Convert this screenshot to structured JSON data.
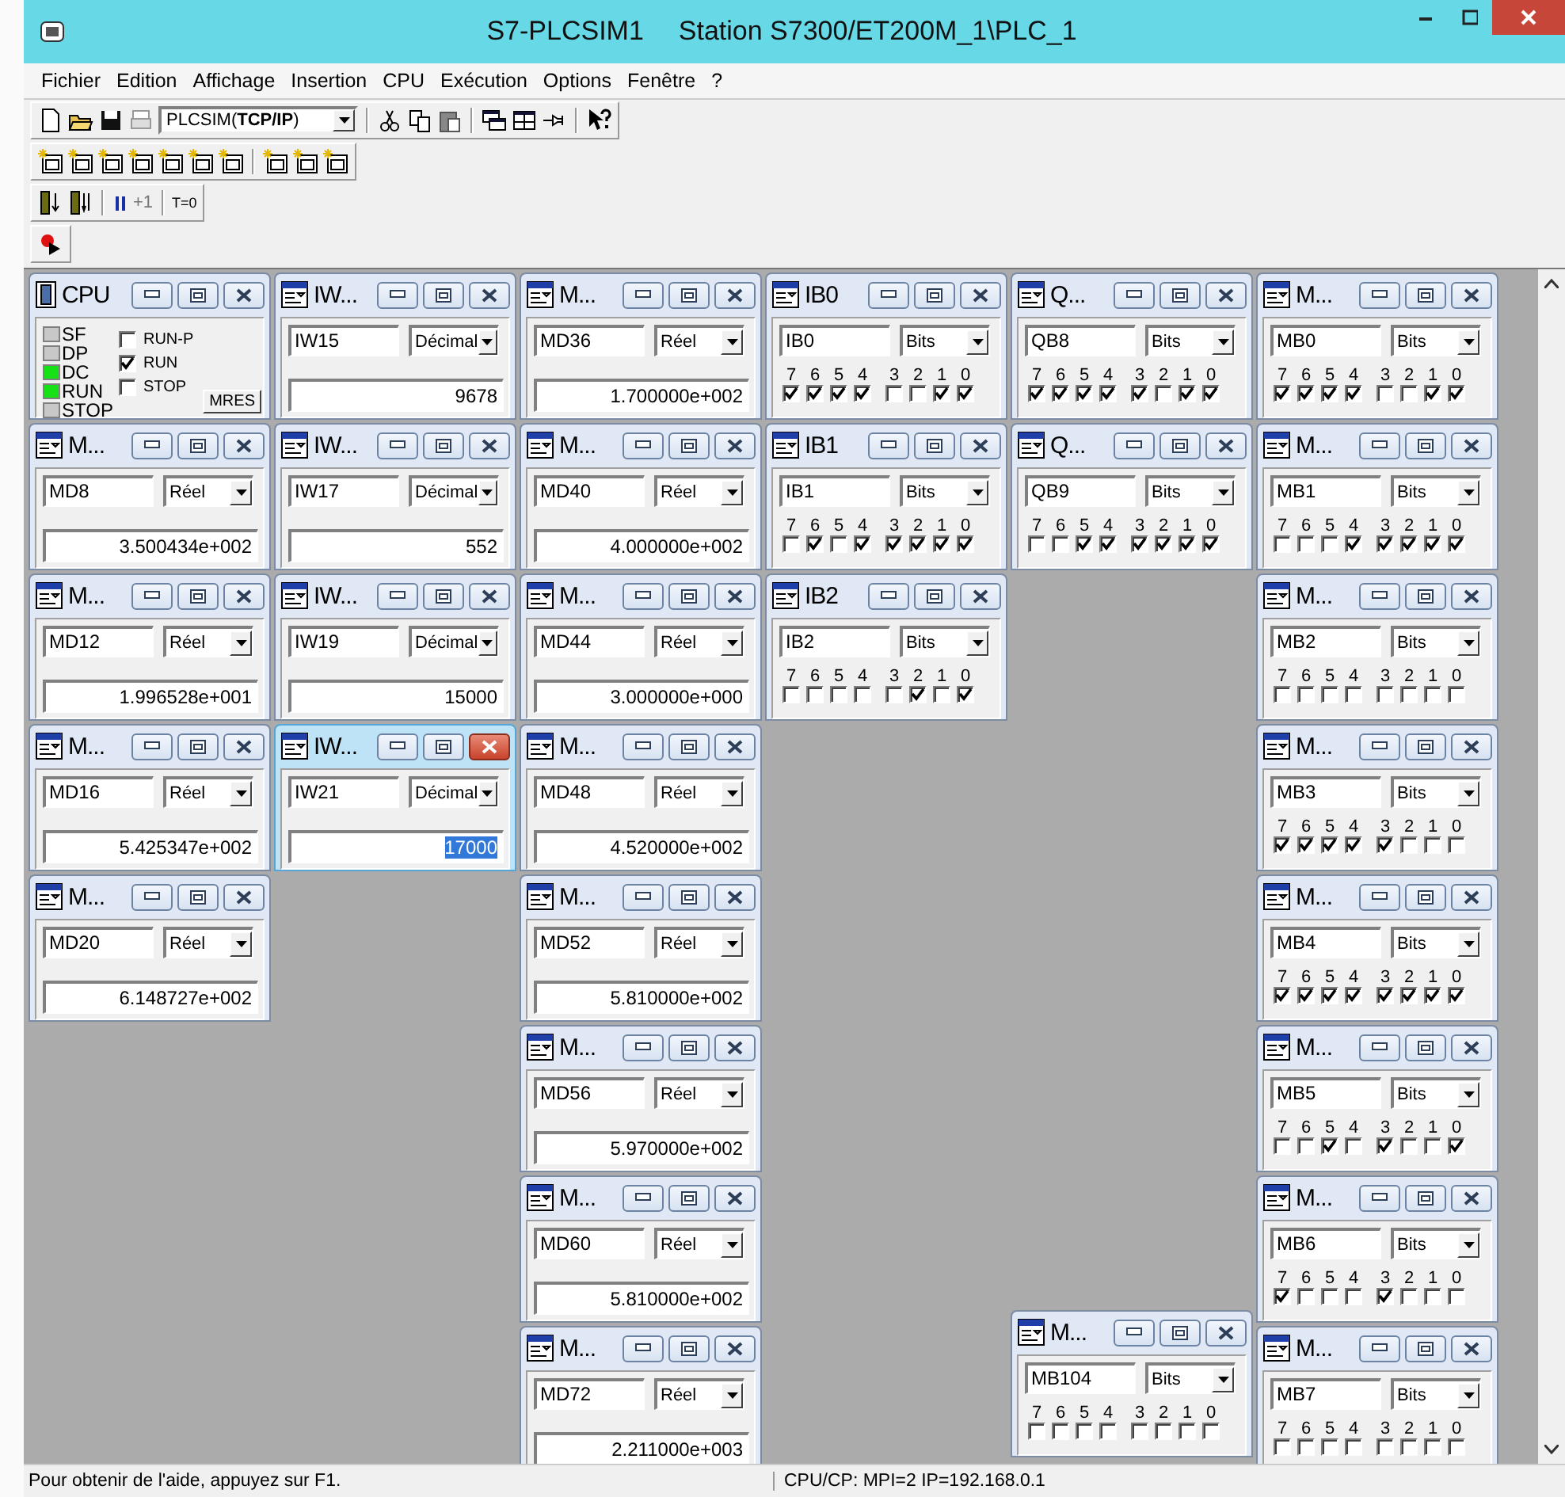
{
  "window": {
    "app": "S7-PLCSIM1",
    "station": "Station S7300/ET200M_1\\PLC_1"
  },
  "menu": [
    "Fichier",
    "Edition",
    "Affichage",
    "Insertion",
    "CPU",
    "Exécution",
    "Options",
    "Fenêtre",
    "?"
  ],
  "toolbar": {
    "connection": "PLCSIM(**TCP/IP**)",
    "step": "+1",
    "timer_reset": "T=0"
  },
  "columns": [
    {
      "windows": [
        {
          "kind": "cpu",
          "title": "CPU",
          "active": false,
          "leds": [
            {
              "label": "SF",
              "on": false
            },
            {
              "label": "DP",
              "on": false
            },
            {
              "label": "DC",
              "on": true
            },
            {
              "label": "RUN",
              "on": true
            },
            {
              "label": "STOP",
              "on": false
            }
          ],
          "modes": [
            {
              "label": "RUN-P",
              "checked": false
            },
            {
              "label": "RUN",
              "checked": true
            },
            {
              "label": "STOP",
              "checked": false
            }
          ],
          "button": "MRES"
        },
        {
          "kind": "value",
          "title": "M...",
          "active": false,
          "address": "MD8",
          "format": "Réel",
          "value": "3.500434e+002"
        },
        {
          "kind": "value",
          "title": "M...",
          "active": false,
          "address": "MD12",
          "format": "Réel",
          "value": "1.996528e+001"
        },
        {
          "kind": "value",
          "title": "M...",
          "active": false,
          "address": "MD16",
          "format": "Réel",
          "value": "5.425347e+002"
        },
        {
          "kind": "value",
          "title": "M...",
          "active": false,
          "address": "MD20",
          "format": "Réel",
          "value": "6.148727e+002"
        }
      ]
    },
    {
      "windows": [
        {
          "kind": "value",
          "title": "IW...",
          "active": false,
          "address": "IW15",
          "format": "Décimal",
          "value": "9678"
        },
        {
          "kind": "value",
          "title": "IW...",
          "active": false,
          "address": "IW17",
          "format": "Décimal",
          "value": "552"
        },
        {
          "kind": "value",
          "title": "IW...",
          "active": false,
          "address": "IW19",
          "format": "Décimal",
          "value": "15000"
        },
        {
          "kind": "value",
          "title": "IW...",
          "active": true,
          "address": "IW21",
          "format": "Décimal",
          "value": "17000"
        }
      ]
    },
    {
      "windows": [
        {
          "kind": "value",
          "title": "M...",
          "active": false,
          "address": "MD36",
          "format": "Réel",
          "value": "1.700000e+002"
        },
        {
          "kind": "value",
          "title": "M...",
          "active": false,
          "address": "MD40",
          "format": "Réel",
          "value": "4.000000e+002"
        },
        {
          "kind": "value",
          "title": "M...",
          "active": false,
          "address": "MD44",
          "format": "Réel",
          "value": "3.000000e+000"
        },
        {
          "kind": "value",
          "title": "M...",
          "active": false,
          "address": "MD48",
          "format": "Réel",
          "value": "4.520000e+002"
        },
        {
          "kind": "value",
          "title": "M...",
          "active": false,
          "address": "MD52",
          "format": "Réel",
          "value": "5.810000e+002"
        },
        {
          "kind": "value",
          "title": "M...",
          "active": false,
          "address": "MD56",
          "format": "Réel",
          "value": "5.970000e+002"
        },
        {
          "kind": "value",
          "title": "M...",
          "active": false,
          "address": "MD60",
          "format": "Réel",
          "value": "5.810000e+002"
        },
        {
          "kind": "value",
          "title": "M...",
          "active": false,
          "address": "MD72",
          "format": "Réel",
          "value": "2.211000e+003"
        }
      ]
    },
    {
      "windows": [
        {
          "kind": "bits",
          "title": "IB0",
          "active": false,
          "address": "IB0",
          "format": "Bits",
          "bits": [
            {
              "label": "7",
              "checked": true
            },
            {
              "label": "6",
              "checked": true
            },
            {
              "label": "5",
              "checked": true
            },
            {
              "label": "4",
              "checked": true
            },
            {
              "label": "3",
              "checked": false
            },
            {
              "label": "2",
              "checked": false
            },
            {
              "label": "1",
              "checked": true
            },
            {
              "label": "0",
              "checked": true
            }
          ]
        },
        {
          "kind": "bits",
          "title": "IB1",
          "active": false,
          "address": "IB1",
          "format": "Bits",
          "bits": [
            {
              "label": "7",
              "checked": false
            },
            {
              "label": "6",
              "checked": true
            },
            {
              "label": "5",
              "checked": false
            },
            {
              "label": "4",
              "checked": true
            },
            {
              "label": "3",
              "checked": true
            },
            {
              "label": "2",
              "checked": true
            },
            {
              "label": "1",
              "checked": true
            },
            {
              "label": "0",
              "checked": true
            }
          ]
        },
        {
          "kind": "bits",
          "title": "IB2",
          "active": false,
          "address": "IB2",
          "format": "Bits",
          "bits": [
            {
              "label": "7",
              "checked": false
            },
            {
              "label": "6",
              "checked": false
            },
            {
              "label": "5",
              "checked": false
            },
            {
              "label": "4",
              "checked": false
            },
            {
              "label": "3",
              "checked": false
            },
            {
              "label": "2",
              "checked": true
            },
            {
              "label": "1",
              "checked": false
            },
            {
              "label": "0",
              "checked": true
            }
          ]
        }
      ]
    },
    {
      "windows": [
        {
          "kind": "bits",
          "title": "Q...",
          "active": false,
          "address": "QB8",
          "format": "Bits",
          "bits": [
            {
              "label": "7",
              "checked": true
            },
            {
              "label": "6",
              "checked": true
            },
            {
              "label": "5",
              "checked": true
            },
            {
              "label": "4",
              "checked": true
            },
            {
              "label": "3",
              "checked": true
            },
            {
              "label": "2",
              "checked": false
            },
            {
              "label": "1",
              "checked": true
            },
            {
              "label": "0",
              "checked": true
            }
          ]
        },
        {
          "kind": "bits",
          "title": "Q...",
          "active": false,
          "address": "QB9",
          "format": "Bits",
          "bits": [
            {
              "label": "7",
              "checked": false
            },
            {
              "label": "6",
              "checked": false
            },
            {
              "label": "5",
              "checked": true
            },
            {
              "label": "4",
              "checked": true
            },
            {
              "label": "3",
              "checked": true
            },
            {
              "label": "2",
              "checked": true
            },
            {
              "label": "1",
              "checked": true
            },
            {
              "label": "0",
              "checked": true
            }
          ]
        },
        {
          "kind": "bits",
          "title": "M...",
          "active": false,
          "address": "MB104",
          "format": "Bits",
          "bits": [
            {
              "label": "7",
              "checked": false
            },
            {
              "label": "6",
              "checked": false
            },
            {
              "label": "5",
              "checked": false
            },
            {
              "label": "4",
              "checked": false
            },
            {
              "label": "3",
              "checked": false
            },
            {
              "label": "2",
              "checked": false
            },
            {
              "label": "1",
              "checked": false
            },
            {
              "label": "0",
              "checked": false
            }
          ]
        }
      ]
    },
    {
      "windows": [
        {
          "kind": "bits",
          "title": "M...",
          "active": false,
          "address": "MB0",
          "format": "Bits",
          "bits": [
            {
              "label": "7",
              "checked": true
            },
            {
              "label": "6",
              "checked": true
            },
            {
              "label": "5",
              "checked": true
            },
            {
              "label": "4",
              "checked": true
            },
            {
              "label": "3",
              "checked": false
            },
            {
              "label": "2",
              "checked": false
            },
            {
              "label": "1",
              "checked": true
            },
            {
              "label": "0",
              "checked": true
            }
          ]
        },
        {
          "kind": "bits",
          "title": "M...",
          "active": false,
          "address": "MB1",
          "format": "Bits",
          "bits": [
            {
              "label": "7",
              "checked": false
            },
            {
              "label": "6",
              "checked": false
            },
            {
              "label": "5",
              "checked": false
            },
            {
              "label": "4",
              "checked": true
            },
            {
              "label": "3",
              "checked": true
            },
            {
              "label": "2",
              "checked": true
            },
            {
              "label": "1",
              "checked": true
            },
            {
              "label": "0",
              "checked": true
            }
          ]
        },
        {
          "kind": "bits",
          "title": "M...",
          "active": false,
          "address": "MB2",
          "format": "Bits",
          "bits": [
            {
              "label": "7",
              "checked": false
            },
            {
              "label": "6",
              "checked": false
            },
            {
              "label": "5",
              "checked": false
            },
            {
              "label": "4",
              "checked": false
            },
            {
              "label": "3",
              "checked": false
            },
            {
              "label": "2",
              "checked": false
            },
            {
              "label": "1",
              "checked": false
            },
            {
              "label": "0",
              "checked": false
            }
          ]
        },
        {
          "kind": "bits",
          "title": "M...",
          "active": false,
          "address": "MB3",
          "format": "Bits",
          "bits": [
            {
              "label": "7",
              "checked": true
            },
            {
              "label": "6",
              "checked": true
            },
            {
              "label": "5",
              "checked": true
            },
            {
              "label": "4",
              "checked": true
            },
            {
              "label": "3",
              "checked": true
            },
            {
              "label": "2",
              "checked": false
            },
            {
              "label": "1",
              "checked": false
            },
            {
              "label": "0",
              "checked": false
            }
          ]
        },
        {
          "kind": "bits",
          "title": "M...",
          "active": false,
          "address": "MB4",
          "format": "Bits",
          "bits": [
            {
              "label": "7",
              "checked": true
            },
            {
              "label": "6",
              "checked": true
            },
            {
              "label": "5",
              "checked": true
            },
            {
              "label": "4",
              "checked": true
            },
            {
              "label": "3",
              "checked": true
            },
            {
              "label": "2",
              "checked": true
            },
            {
              "label": "1",
              "checked": true
            },
            {
              "label": "0",
              "checked": true
            }
          ]
        },
        {
          "kind": "bits",
          "title": "M...",
          "active": false,
          "address": "MB5",
          "format": "Bits",
          "bits": [
            {
              "label": "7",
              "checked": false
            },
            {
              "label": "6",
              "checked": false
            },
            {
              "label": "5",
              "checked": true
            },
            {
              "label": "4",
              "checked": false
            },
            {
              "label": "3",
              "checked": true
            },
            {
              "label": "2",
              "checked": false
            },
            {
              "label": "1",
              "checked": false
            },
            {
              "label": "0",
              "checked": true
            }
          ]
        },
        {
          "kind": "bits",
          "title": "M...",
          "active": false,
          "address": "MB6",
          "format": "Bits",
          "bits": [
            {
              "label": "7",
              "checked": true
            },
            {
              "label": "6",
              "checked": false
            },
            {
              "label": "5",
              "checked": false
            },
            {
              "label": "4",
              "checked": false
            },
            {
              "label": "3",
              "checked": true
            },
            {
              "label": "2",
              "checked": false
            },
            {
              "label": "1",
              "checked": false
            },
            {
              "label": "0",
              "checked": false
            }
          ]
        },
        {
          "kind": "bits",
          "title": "M...",
          "active": false,
          "address": "MB7",
          "format": "Bits",
          "bits": [
            {
              "label": "7",
              "checked": false
            },
            {
              "label": "6",
              "checked": false
            },
            {
              "label": "5",
              "checked": false
            },
            {
              "label": "4",
              "checked": false
            },
            {
              "label": "3",
              "checked": false
            },
            {
              "label": "2",
              "checked": false
            },
            {
              "label": "1",
              "checked": false
            },
            {
              "label": "0",
              "checked": false
            }
          ]
        }
      ]
    }
  ],
  "status_bar": {
    "help": "Pour obtenir de l'aide, appuyez sur F1.",
    "connection": "CPU/CP:  MPI=2 IP=192.168.0.1"
  }
}
